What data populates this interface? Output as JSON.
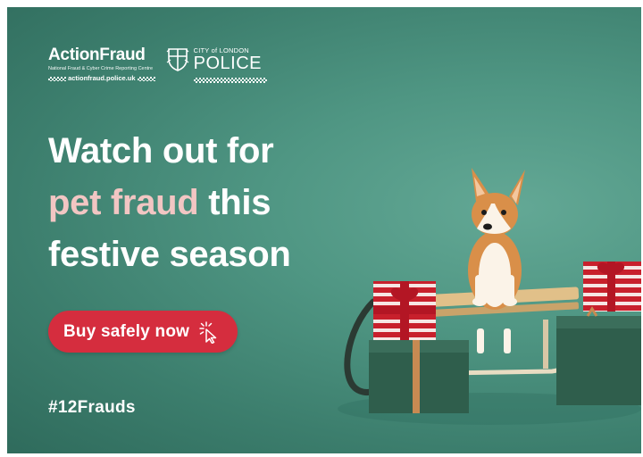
{
  "logo": {
    "actionfraud": "ActionFraud",
    "actionfraud_subtitle": "National Fraud & Cyber Crime Reporting Centre",
    "url": "actionfraud.police.uk",
    "police_small": "CITY of LONDON",
    "police_big": "POLICE"
  },
  "headline": {
    "line1": "Watch out for",
    "line2_highlight": "pet fraud",
    "line2_rest": " this",
    "line3": "festive season"
  },
  "cta": {
    "label": "Buy safely now",
    "icon": "cursor-click-icon"
  },
  "hashtag": "#12Frauds",
  "colors": {
    "background": "#4f9683",
    "cta": "#d52d3e",
    "highlight": "#f2c6c3",
    "text": "#ffffff"
  }
}
